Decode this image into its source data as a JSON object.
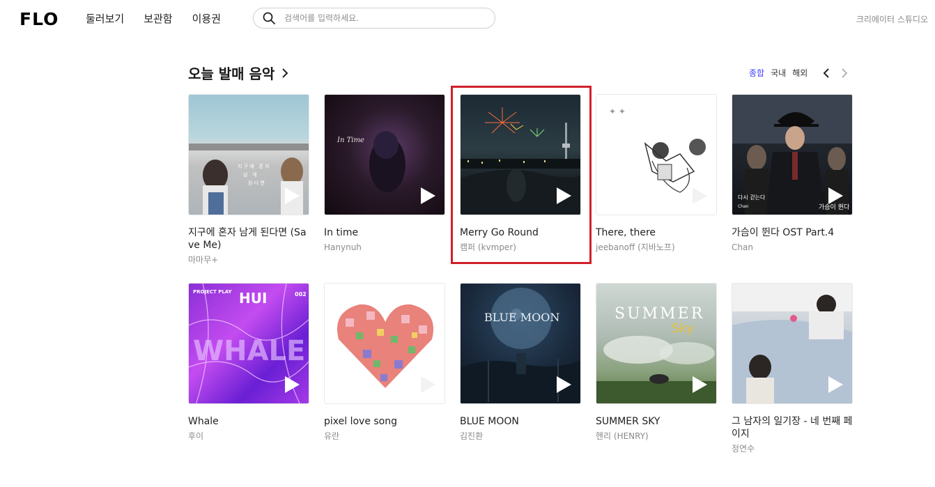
{
  "header": {
    "logo": "FLO",
    "nav": [
      "둘러보기",
      "보관함",
      "이용권"
    ],
    "search_placeholder": "검색어를 입력하세요.",
    "creator_link": "크리에이터 스튜디오"
  },
  "section": {
    "title": "오늘 발매 음악",
    "filters": [
      "종합",
      "국내",
      "해외"
    ],
    "active_filter": "종합"
  },
  "albums": [
    {
      "title": "지구에 혼자 남게 된다면 (Save Me)",
      "artist": "마마무+"
    },
    {
      "title": "In time",
      "artist": "Hanynuh"
    },
    {
      "title": "Merry Go Round",
      "artist": "캠퍼 (kvmper)"
    },
    {
      "title": "There, there",
      "artist": "jeebanoff (지바노프)"
    },
    {
      "title": "가슴이 뛴다 OST Part.4",
      "artist": "Chan"
    },
    {
      "title": "Whale",
      "artist": "후이"
    },
    {
      "title": "pixel love song",
      "artist": "유란"
    },
    {
      "title": "BLUE MOON",
      "artist": "김진환"
    },
    {
      "title": "SUMMER SKY",
      "artist": "헨리 (HENRY)"
    },
    {
      "title": "그 남자의 일기장 - 네 번째 페이지",
      "artist": "정연수"
    }
  ],
  "cover_text": {
    "in_time": "In Time",
    "whale_project": "PROJECT PLAY",
    "whale_hui": "HUI",
    "whale_no": "002",
    "whale_word": "WHALE",
    "blue_moon": "BLUE MOON",
    "summer": "SUMMER",
    "sky": "Sky",
    "heart_chan": "Chan",
    "heart_left": "다시 걷는다",
    "heart_right": "가슴이 뛴다"
  },
  "colors": {
    "accent_filter": "#3f3fff",
    "highlight_box": "#d0202a"
  }
}
